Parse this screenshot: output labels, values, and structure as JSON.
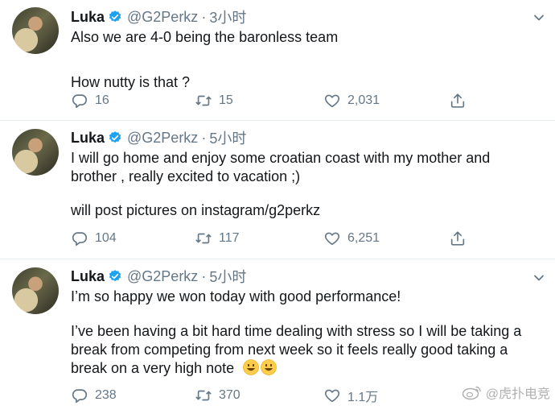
{
  "tweets": [
    {
      "name": "Luka",
      "handle": "@G2Perkz",
      "dot": "·",
      "time": "3小时",
      "lines": [
        "Also we are 4-0 being the baronless team",
        "",
        "How nutty is that ?"
      ],
      "replies": "16",
      "retweets": "15",
      "likes": "2,031"
    },
    {
      "name": "Luka",
      "handle": "@G2Perkz",
      "dot": "·",
      "time": "5小时",
      "lines": [
        "I will go home and enjoy some croatian coast with my mother and",
        "brother , really excited to vacation ;)",
        "",
        "will post pictures on instagram/g2perkz"
      ],
      "replies": "104",
      "retweets": "117",
      "likes": "6,251"
    },
    {
      "name": "Luka",
      "handle": "@G2Perkz",
      "dot": "·",
      "time": "5小时",
      "lines": [
        "I’m so happy we won today with good performance!",
        "",
        "I’ve been having a bit hard time dealing with stress so I will be taking a",
        "break from competing from next week so it feels really good taking a",
        "break on a very high note"
      ],
      "replies": "238",
      "retweets": "370",
      "likes": "1.1万"
    }
  ],
  "watermark": "@虎扑电竞",
  "colors": {
    "text": "#14171a",
    "secondary": "#657786",
    "verified": "#1da1f2",
    "divider": "#e6ecf0"
  },
  "icons": [
    "verified-badge-icon",
    "chevron-down-icon",
    "reply-icon",
    "retweet-icon",
    "like-icon",
    "share-icon",
    "smiley-emoji-icon",
    "weibo-logo-icon"
  ]
}
